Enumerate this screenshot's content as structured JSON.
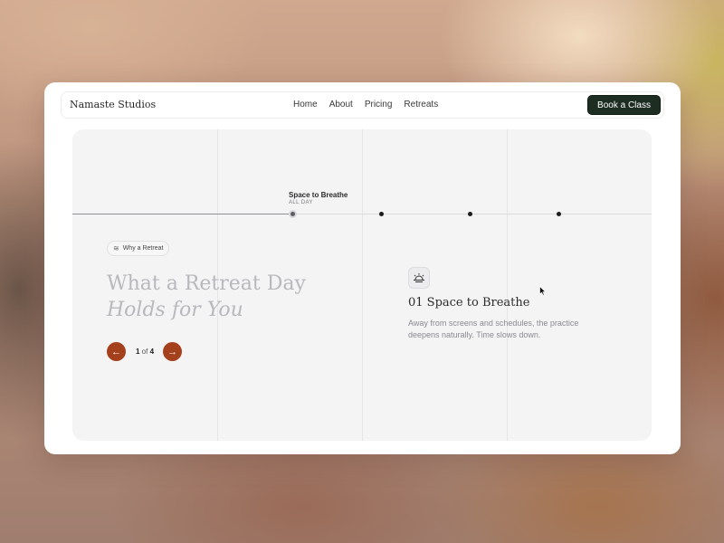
{
  "navbar": {
    "brand": "Namaste Studios",
    "links": [
      "Home",
      "About",
      "Pricing",
      "Retreats"
    ],
    "cta_label": "Book a Class",
    "cta_color": "#1d2d22"
  },
  "timeline": {
    "active_step": {
      "title": "Space to Breathe",
      "subtitle": "ALL DAY"
    },
    "total_points": 4,
    "active_index": 1
  },
  "hero": {
    "chip_icon": "waves-icon",
    "chip_label": "Why a Retreat",
    "headline_line1": "What a Retreat Day",
    "headline_line2": "Holds for You",
    "pager": {
      "prev_icon": "←",
      "next_icon": "→",
      "current": "1",
      "separator": " of ",
      "total": "4",
      "button_color": "#a5401c"
    }
  },
  "feature": {
    "icon": "sunrise-icon",
    "title": "01 Space to Breathe",
    "description": "Away from screens and schedules, the practice deepens naturally. Time slows down."
  }
}
